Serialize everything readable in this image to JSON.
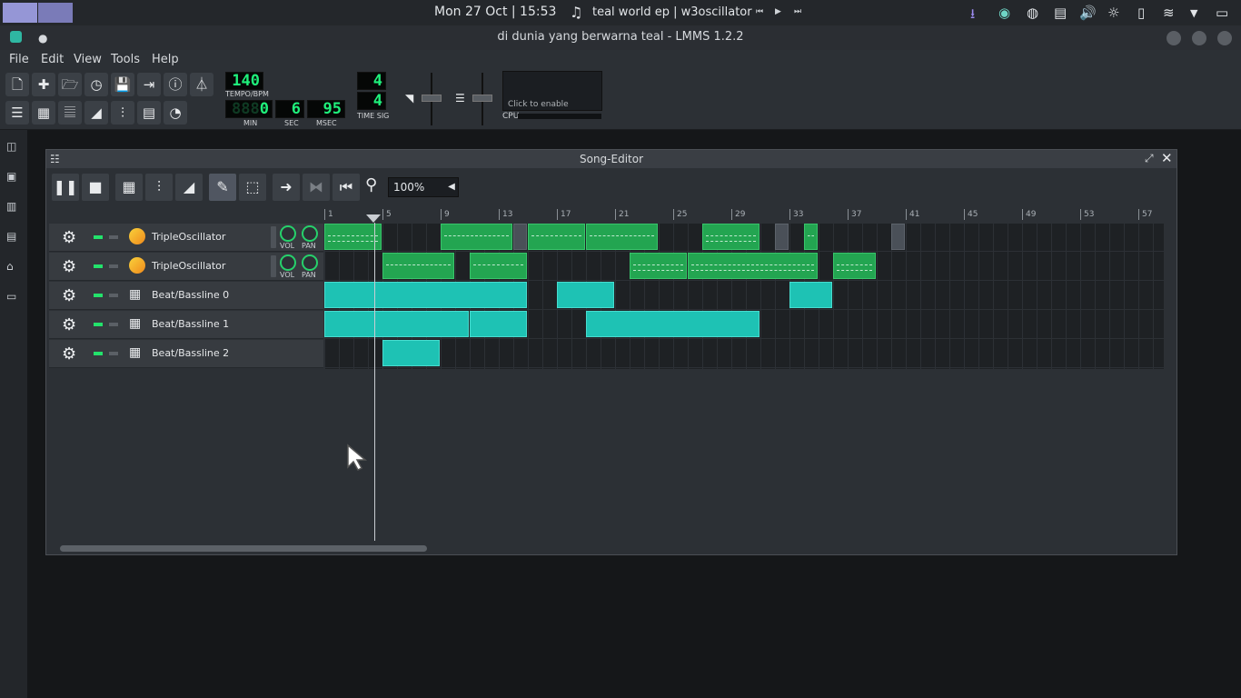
{
  "topbar": {
    "clock": "Mon 27 Oct | 15:53",
    "media_title": "teal world ep | w3oscillator"
  },
  "window": {
    "title": "di dunia yang berwarna teal - LMMS 1.2.2"
  },
  "menubar": {
    "items": [
      "File",
      "Edit",
      "View",
      "Tools",
      "Help"
    ]
  },
  "toolbar": {
    "tempo": "140",
    "tempo_label": "TEMPO/BPM",
    "min": "0",
    "min_ghost": "888",
    "sec": "6",
    "msec": "95",
    "min_label": "MIN",
    "sec_label": "SEC",
    "msec_label": "MSEC",
    "timesig_num": "4",
    "timesig_den": "4",
    "timesig_label": "TIME SIG",
    "cpu_enable": "Click to enable",
    "cpu_label": "CPU"
  },
  "song_editor": {
    "title": "Song-Editor",
    "zoom": "100%",
    "ruler": [
      "1",
      "5",
      "9",
      "13",
      "17",
      "21",
      "25",
      "29",
      "33",
      "37",
      "41",
      "45",
      "49",
      "53",
      "57"
    ],
    "tracks": [
      {
        "name": "TripleOscillator",
        "type": "instrument",
        "vol_label": "VOL",
        "pan_label": "PAN"
      },
      {
        "name": "TripleOscillator",
        "type": "instrument",
        "vol_label": "VOL",
        "pan_label": "PAN"
      },
      {
        "name": "Beat/Bassline 0",
        "type": "bb"
      },
      {
        "name": "Beat/Bassline 1",
        "type": "bb"
      },
      {
        "name": "Beat/Bassline 2",
        "type": "bb"
      }
    ]
  },
  "colors": {
    "lcd_green": "#1ff07b",
    "pattern_green": "#23a551",
    "bb_teal": "#1ec2b4",
    "workspace_accent": "#9596d6"
  }
}
